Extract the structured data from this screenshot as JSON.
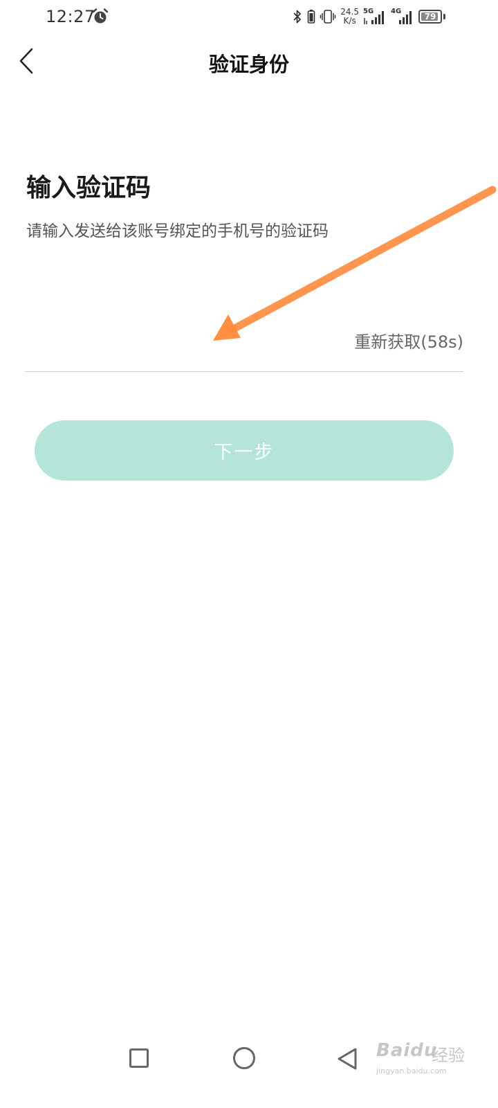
{
  "status_bar": {
    "time": "12:27",
    "net_speed_value": "24.5",
    "net_speed_unit": "K/s",
    "network_1": "5G",
    "network_2": "4G",
    "battery_percent": "79"
  },
  "nav": {
    "title": "验证身份"
  },
  "form": {
    "heading": "输入验证码",
    "description": "请输入发送给该账号绑定的手机号的验证码",
    "code_value": "",
    "resend_label": "重新获取(58s)",
    "next_label": "下一步"
  },
  "watermark": {
    "brand": "Baidu",
    "brand_cn": "经验",
    "url": "jingyan.baidu.com"
  },
  "colors": {
    "button_disabled": "#b5e5d9",
    "annotation_arrow": "#ff8a3c"
  }
}
